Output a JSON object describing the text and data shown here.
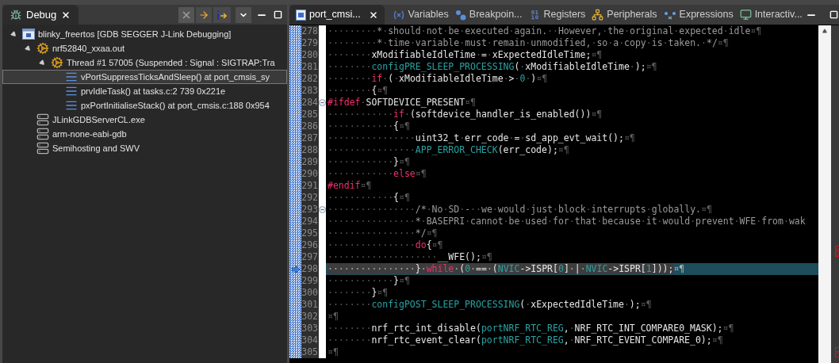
{
  "debug_view": {
    "tab": {
      "title": "Debug",
      "selected": true
    },
    "tree": [
      {
        "label": "blinky_freertos [GDB SEGGER J-Link Debugging]",
        "kind": "launch",
        "expanded": true,
        "selected": false,
        "children": [
          {
            "label": "nrf52840_xxaa.out",
            "kind": "process",
            "expanded": true,
            "selected": false,
            "children": [
              {
                "label": "Thread #1 57005 (Suspended : Signal : SIGTRAP:Tra",
                "kind": "thread",
                "expanded": true,
                "selected": false,
                "children": [
                  {
                    "label": "vPortSuppressTicksAndSleep() at port_cmsis_sy",
                    "kind": "frame",
                    "selected": true
                  },
                  {
                    "label": "prvIdleTask() at tasks.c:2 739 0x221e",
                    "kind": "frame",
                    "selected": false
                  },
                  {
                    "label": "pxPortInitialiseStack() at port_cmsis.c:188 0x954",
                    "kind": "frame",
                    "selected": false
                  }
                ]
              }
            ]
          },
          {
            "label": "JLinkGDBServerCL.exe",
            "kind": "server",
            "selected": false
          },
          {
            "label": "arm-none-eabi-gdb",
            "kind": "server",
            "selected": false
          },
          {
            "label": "Semihosting and SWV",
            "kind": "server",
            "selected": false
          }
        ]
      }
    ]
  },
  "editor_tabs": [
    {
      "title": "port_cmsi...",
      "kind": "file",
      "selected": true
    },
    {
      "title": "Variables",
      "kind": "variables",
      "selected": false
    },
    {
      "title": "Breakpoin...",
      "kind": "breakpoints",
      "selected": false
    },
    {
      "title": "Registers",
      "kind": "registers",
      "selected": false
    },
    {
      "title": "Peripherals",
      "kind": "peripherals",
      "selected": false
    },
    {
      "title": "Expressions",
      "kind": "expressions",
      "selected": false
    },
    {
      "title": "Interactiv...",
      "kind": "console",
      "selected": false
    }
  ],
  "code_lines": [
    {
      "number": "278",
      "current": false,
      "foldable": false,
      "segments": [
        {
          "kind": "comment",
          "text": "·········*·should·not·be·executed·again.··However,·the·original·expected·idle¤¶"
        }
      ]
    },
    {
      "number": "279",
      "current": false,
      "foldable": false,
      "segments": [
        {
          "kind": "comment",
          "text": "·········*·time·variable·must·remain·unmodified,·so·a·copy·is·taken.·*/¤¶"
        }
      ]
    },
    {
      "number": "280",
      "current": false,
      "foldable": false,
      "segments": [
        {
          "kind": "plain",
          "text": "········xModifiableIdleTime·=·xExpectedIdleTime;¤¶"
        }
      ]
    },
    {
      "number": "281",
      "current": false,
      "foldable": false,
      "segments": [
        {
          "kind": "plain",
          "text": "········"
        },
        {
          "kind": "macro",
          "text": "configPRE_SLEEP_PROCESSING"
        },
        {
          "kind": "plain",
          "text": "(·xModifiableIdleTime·);¤¶"
        }
      ]
    },
    {
      "number": "282",
      "current": false,
      "foldable": false,
      "segments": [
        {
          "kind": "plain",
          "text": "········"
        },
        {
          "kind": "keyword",
          "text": "if"
        },
        {
          "kind": "plain",
          "text": "·(·xModifiableIdleTime·>·"
        },
        {
          "kind": "number",
          "text": "0"
        },
        {
          "kind": "plain",
          "text": "·)¤¶"
        }
      ]
    },
    {
      "number": "283",
      "current": false,
      "foldable": false,
      "segments": [
        {
          "kind": "plain",
          "text": "········{¤¶"
        }
      ]
    },
    {
      "number": "284",
      "current": false,
      "foldable": true,
      "segments": [
        {
          "kind": "keyword",
          "text": "#ifdef"
        },
        {
          "kind": "plain",
          "text": "·SOFTDEVICE_PRESENT¤¶"
        }
      ]
    },
    {
      "number": "285",
      "current": false,
      "foldable": false,
      "segments": [
        {
          "kind": "plain",
          "text": "············"
        },
        {
          "kind": "keyword",
          "text": "if"
        },
        {
          "kind": "plain",
          "text": "·(softdevice_handler_is_enabled())¤¶"
        }
      ]
    },
    {
      "number": "286",
      "current": false,
      "foldable": false,
      "segments": [
        {
          "kind": "plain",
          "text": "············{¤¶"
        }
      ]
    },
    {
      "number": "287",
      "current": false,
      "foldable": false,
      "segments": [
        {
          "kind": "plain",
          "text": "················uint32_t·err_code·=·sd_app_evt_wait();¤¶"
        }
      ]
    },
    {
      "number": "288",
      "current": false,
      "foldable": false,
      "segments": [
        {
          "kind": "plain",
          "text": "················"
        },
        {
          "kind": "macro",
          "text": "APP_ERROR_CHECK"
        },
        {
          "kind": "plain",
          "text": "(err_code);¤¶"
        }
      ]
    },
    {
      "number": "289",
      "current": false,
      "foldable": false,
      "segments": [
        {
          "kind": "plain",
          "text": "············}¤¶"
        }
      ]
    },
    {
      "number": "290",
      "current": false,
      "foldable": false,
      "segments": [
        {
          "kind": "plain",
          "text": "············"
        },
        {
          "kind": "keyword",
          "text": "else"
        },
        {
          "kind": "plain",
          "text": "¤¶"
        }
      ]
    },
    {
      "number": "291",
      "current": false,
      "foldable": false,
      "segments": [
        {
          "kind": "keyword",
          "text": "#endif"
        },
        {
          "kind": "plain",
          "text": "¤¶"
        }
      ]
    },
    {
      "number": "292",
      "current": false,
      "foldable": false,
      "segments": [
        {
          "kind": "plain",
          "text": "············{¤¶"
        }
      ]
    },
    {
      "number": "293",
      "current": false,
      "foldable": true,
      "segments": [
        {
          "kind": "comment",
          "text": "················/*·No·SD·-··we·would·just·block·interrupts·globally.¤¶"
        }
      ]
    },
    {
      "number": "294",
      "current": false,
      "foldable": false,
      "segments": [
        {
          "kind": "comment",
          "text": "················*·BASEPRI·cannot·be·used·for·that·because·it·would·prevent·WFE·from·wak"
        }
      ]
    },
    {
      "number": "295",
      "current": false,
      "foldable": false,
      "segments": [
        {
          "kind": "comment",
          "text": "················*/¤¶"
        }
      ]
    },
    {
      "number": "296",
      "current": false,
      "foldable": false,
      "segments": [
        {
          "kind": "plain",
          "text": "················"
        },
        {
          "kind": "keyword",
          "text": "do"
        },
        {
          "kind": "plain",
          "text": "{¤¶"
        }
      ]
    },
    {
      "number": "297",
      "current": false,
      "foldable": false,
      "segments": [
        {
          "kind": "plain",
          "text": "····················__WFE();¤¶"
        }
      ]
    },
    {
      "number": "298",
      "current": true,
      "foldable": false,
      "segments": [
        {
          "kind": "plain",
          "text": "················}·"
        },
        {
          "kind": "keyword",
          "text": "while"
        },
        {
          "kind": "plain",
          "text": "·("
        },
        {
          "kind": "number",
          "text": "0"
        },
        {
          "kind": "plain",
          "text": "·==·("
        },
        {
          "kind": "macro",
          "text": "NVIC"
        },
        {
          "kind": "plain",
          "text": "->ISPR["
        },
        {
          "kind": "number",
          "text": "0"
        },
        {
          "kind": "plain",
          "text": "]·|·"
        },
        {
          "kind": "macro",
          "text": "NVIC"
        },
        {
          "kind": "plain",
          "text": "->ISPR["
        },
        {
          "kind": "number",
          "text": "1"
        },
        {
          "kind": "plain",
          "text": "]));"
        },
        {
          "kind": "plain",
          "text": "¤¶"
        }
      ]
    },
    {
      "number": "299",
      "current": false,
      "foldable": false,
      "segments": [
        {
          "kind": "plain",
          "text": "············}¤¶"
        }
      ]
    },
    {
      "number": "300",
      "current": false,
      "foldable": false,
      "segments": [
        {
          "kind": "plain",
          "text": "········}¤¶"
        }
      ]
    },
    {
      "number": "301",
      "current": false,
      "foldable": false,
      "segments": [
        {
          "kind": "plain",
          "text": "········"
        },
        {
          "kind": "macro",
          "text": "configPOST_SLEEP_PROCESSING"
        },
        {
          "kind": "plain",
          "text": "(·xExpectedIdleTime·);¤¶"
        }
      ]
    },
    {
      "number": "302",
      "current": false,
      "foldable": false,
      "segments": [
        {
          "kind": "plain",
          "text": "¤¶"
        }
      ]
    },
    {
      "number": "303",
      "current": false,
      "foldable": false,
      "segments": [
        {
          "kind": "plain",
          "text": "········nrf_rtc_int_disable("
        },
        {
          "kind": "macro",
          "text": "portNRF_RTC_REG"
        },
        {
          "kind": "plain",
          "text": ",·NRF_RTC_INT_COMPARE0_MASK);¤¶"
        }
      ]
    },
    {
      "number": "304",
      "current": false,
      "foldable": false,
      "segments": [
        {
          "kind": "plain",
          "text": "········nrf_rtc_event_clear("
        },
        {
          "kind": "macro",
          "text": "portNRF_RTC_REG"
        },
        {
          "kind": "plain",
          "text": ",·NRF_RTC_EVENT_COMPARE_0);¤¶"
        }
      ]
    },
    {
      "number": "305",
      "current": false,
      "foldable": false,
      "segments": [
        {
          "kind": "plain",
          "text": "¤¶"
        }
      ]
    }
  ]
}
